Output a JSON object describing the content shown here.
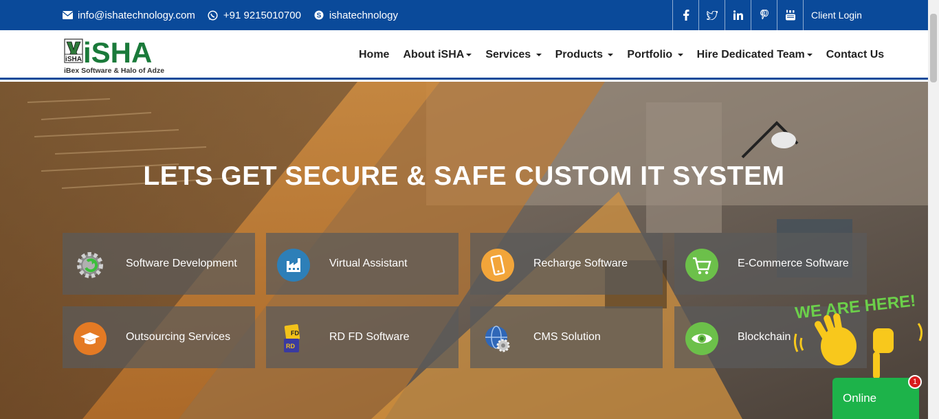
{
  "topbar": {
    "email": "info@ishatechnology.com",
    "phone": "+91 9215010700",
    "skype": "ishatechnology",
    "social": {
      "facebook": "f",
      "twitter": "t",
      "linkedin": "in",
      "pinterest": "p",
      "youtube": "yt"
    },
    "client_login": "Client Login"
  },
  "logo": {
    "small_text": "iSHA",
    "main_text": "iSHA",
    "tagline": "iBex Software & Halo of Adze"
  },
  "nav": [
    {
      "label": "Home",
      "dropdown": false
    },
    {
      "label": "About iSHA",
      "dropdown": true
    },
    {
      "label": "Services",
      "dropdown": true
    },
    {
      "label": "Products",
      "dropdown": true
    },
    {
      "label": "Portfolio",
      "dropdown": true
    },
    {
      "label": "Hire Dedicated Team",
      "dropdown": true
    },
    {
      "label": "Contact Us",
      "dropdown": false
    }
  ],
  "hero": {
    "title": "LETS GET SECURE & SAFE CUSTOM IT SYSTEM"
  },
  "services": [
    {
      "label": "Software Development",
      "icon": "gear-icon"
    },
    {
      "label": "Virtual Assistant",
      "icon": "factory-icon"
    },
    {
      "label": "Recharge Software",
      "icon": "mobile-icon"
    },
    {
      "label": "E-Commerce Software",
      "icon": "cart-icon"
    },
    {
      "label": "Outsourcing Services",
      "icon": "graduation-cap-icon"
    },
    {
      "label": "RD FD Software",
      "icon": "rd-fd-icon"
    },
    {
      "label": "CMS Solution",
      "icon": "globe-gear-icon"
    },
    {
      "label": "Blockchain",
      "icon": "eye-icon"
    }
  ],
  "chat": {
    "label": "Online",
    "badge": "1",
    "banner": "WE ARE HERE!"
  },
  "colors": {
    "topbar": "#0a4a9a",
    "logo_green": "#1a7a3a",
    "chat_green": "#1db34a",
    "tile_bg": "rgba(90,90,90,0.72)"
  }
}
